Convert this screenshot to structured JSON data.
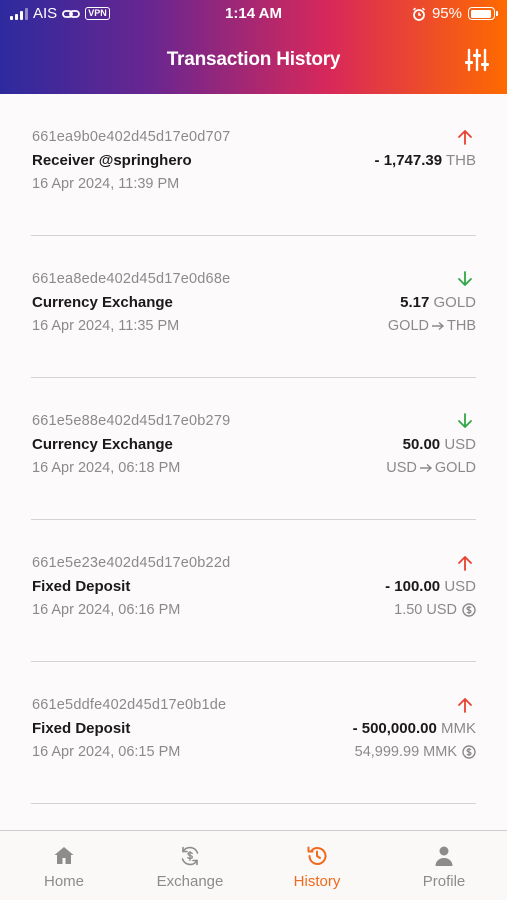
{
  "status_bar": {
    "carrier": "AIS",
    "vpn": "VPN",
    "time": "1:14 AM",
    "battery": "95%"
  },
  "header": {
    "title": "Transaction History",
    "filter_icon": "sliders-icon"
  },
  "colors": {
    "out": "#e8412f",
    "in": "#2fa745",
    "accent": "#f06a1d"
  },
  "transactions": [
    {
      "id": "661ea9b0e402d45d17e0d707",
      "name": "Receiver @springhero",
      "date": "16 Apr 2024, 11:39 PM",
      "direction": "out",
      "amount": "- 1,747.39",
      "currency": "THB"
    },
    {
      "id": "661ea8ede402d45d17e0d68e",
      "name": "Currency Exchange",
      "date": "16 Apr 2024, 11:35 PM",
      "direction": "in",
      "amount": "5.17",
      "currency": "GOLD",
      "from": "GOLD",
      "to": "THB"
    },
    {
      "id": "661e5e88e402d45d17e0b279",
      "name": "Currency Exchange",
      "date": "16 Apr 2024, 06:18 PM",
      "direction": "in",
      "amount": "50.00",
      "currency": "USD",
      "from": "USD",
      "to": "GOLD"
    },
    {
      "id": "661e5e23e402d45d17e0b22d",
      "name": "Fixed Deposit",
      "date": "16 Apr 2024, 06:16 PM",
      "direction": "out",
      "amount": "- 100.00",
      "currency": "USD",
      "interest": "1.50 USD"
    },
    {
      "id": "661e5ddfe402d45d17e0b1de",
      "name": "Fixed Deposit",
      "date": "16 Apr 2024, 06:15 PM",
      "direction": "out",
      "amount": "- 500,000.00",
      "currency": "MMK",
      "interest": "54,999.99 MMK"
    }
  ],
  "tabs": [
    {
      "label": "Home",
      "icon": "home-icon"
    },
    {
      "label": "Exchange",
      "icon": "exchange-icon"
    },
    {
      "label": "History",
      "icon": "history-icon",
      "active": true
    },
    {
      "label": "Profile",
      "icon": "profile-icon"
    }
  ]
}
